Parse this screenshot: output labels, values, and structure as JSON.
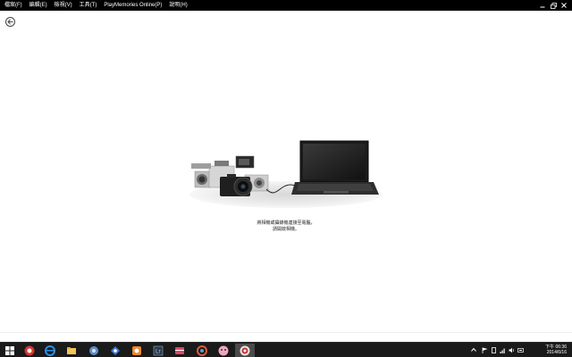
{
  "menu": {
    "items": [
      {
        "label": "檔案(F)"
      },
      {
        "label": "編輯(E)"
      },
      {
        "label": "檢視(V)"
      },
      {
        "label": "工具(T)"
      },
      {
        "label": "PlayMemories Online(P)"
      },
      {
        "label": "說明(H)"
      }
    ]
  },
  "main": {
    "caption_line1": "將相機或攝錄機連接至電腦，",
    "caption_line2": "請開啟相機。"
  },
  "taskbar": {
    "time": "下午 06:36",
    "date": "2014/6/16"
  },
  "colors": {
    "menubar_bg": "#000000",
    "taskbar_bg": "#1a1a1a",
    "page_bg": "#ffffff"
  }
}
